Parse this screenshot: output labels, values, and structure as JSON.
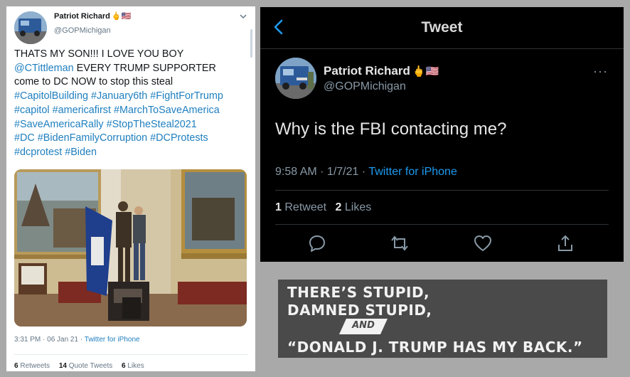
{
  "left_tweet": {
    "display_name": "Patriot Richard",
    "name_emoji": "🖕🇺🇸",
    "handle": "@GOPMichigan",
    "body_lines": [
      [
        {
          "t": "THATS MY SON!!! I LOVE YOU BOY",
          "tag": false
        }
      ],
      [
        {
          "t": "@CTittleman",
          "tag": true
        },
        {
          "t": " EVERY TRUMP SUPPORTER",
          "tag": false
        }
      ],
      [
        {
          "t": "come to DC NOW to stop this steal",
          "tag": false
        }
      ],
      [
        {
          "t": "#CapitolBuilding #January6th #FightForTrump",
          "tag": true
        }
      ],
      [
        {
          "t": "#capitol #americafirst #MarchToSaveAmerica",
          "tag": true
        }
      ],
      [
        {
          "t": "#SaveAmericaRally #StopTheSteal2021",
          "tag": true
        }
      ],
      [
        {
          "t": "#DC #BidenFamilyCorruption #DCProtests",
          "tag": true
        }
      ],
      [
        {
          "t": "#dcprotest #Biden",
          "tag": true
        }
      ]
    ],
    "timestamp": "3:31 PM · 06 Jan 21 · ",
    "source": "Twitter for iPhone",
    "retweets_count": "6",
    "retweets_label": "Retweets",
    "quotes_count": "14",
    "quotes_label": "Quote Tweets",
    "likes_count": "6",
    "likes_label": "Likes",
    "icons": {
      "menu": "chevron-down-icon",
      "photo": "photo-capitol-rotunda"
    }
  },
  "right_tweet": {
    "header_title": "Tweet",
    "display_name": "Patriot Richard",
    "name_emoji": "🖕🇺🇸",
    "handle": "@GOPMichigan",
    "more": "···",
    "text": "Why is the FBI contacting me?",
    "timestamp": "9:58 AM · 1/7/21 · ",
    "source": "Twitter for iPhone",
    "retweet_count": "1",
    "retweet_label": "Retweet",
    "likes_count": "2",
    "likes_label": "Likes",
    "icons": [
      "reply-icon",
      "retweet-icon",
      "like-icon",
      "share-icon"
    ]
  },
  "sign": {
    "line1": "THERE’S STUPID,",
    "line2": "DAMNED STUPID,",
    "and": "AND",
    "line3": "“DONALD J. TRUMP HAS MY BACK.”"
  },
  "colors": {
    "link_blue_light": "#1f7fbf",
    "link_blue_dark": "#1d9bf0",
    "dark_bg": "#000000",
    "sign_bg": "#4a4a4a",
    "page_bg": "#a9a9a9"
  }
}
